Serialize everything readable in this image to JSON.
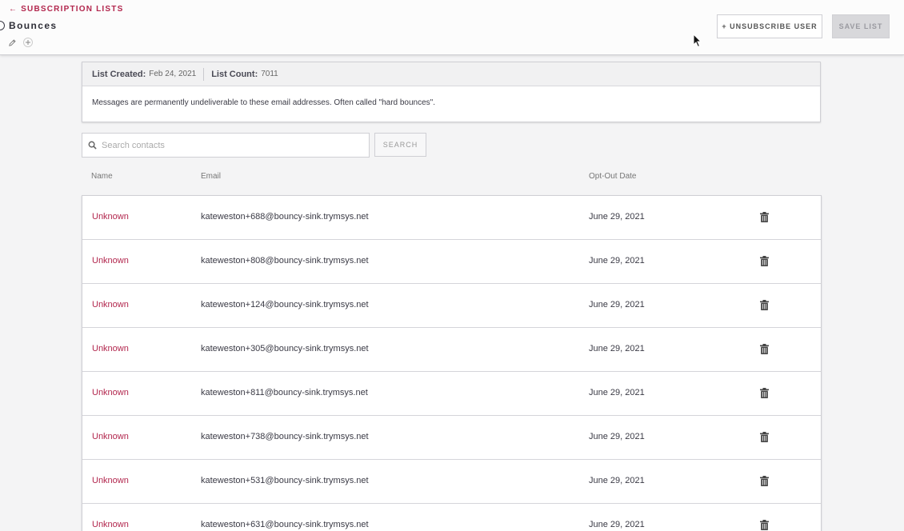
{
  "header": {
    "back_label": "← SUBSCRIPTION LISTS",
    "title": "Bounces",
    "unsubscribe_label": "+ UNSUBSCRIBE USER",
    "save_label": "SAVE LIST"
  },
  "info": {
    "created_label": "List Created:",
    "created_value": "Feb 24, 2021",
    "count_label": "List Count:",
    "count_value": "7011",
    "description": "Messages are permanently undeliverable to these email addresses. Often called \"hard bounces\"."
  },
  "search": {
    "placeholder": "Search contacts",
    "button_label": "SEARCH"
  },
  "table": {
    "columns": [
      "Name",
      "Email",
      "Opt-Out Date"
    ],
    "rows": [
      {
        "name": "Unknown",
        "email": "kateweston+688@bouncy-sink.trymsys.net",
        "date": "June 29, 2021"
      },
      {
        "name": "Unknown",
        "email": "kateweston+808@bouncy-sink.trymsys.net",
        "date": "June 29, 2021"
      },
      {
        "name": "Unknown",
        "email": "kateweston+124@bouncy-sink.trymsys.net",
        "date": "June 29, 2021"
      },
      {
        "name": "Unknown",
        "email": "kateweston+305@bouncy-sink.trymsys.net",
        "date": "June 29, 2021"
      },
      {
        "name": "Unknown",
        "email": "kateweston+811@bouncy-sink.trymsys.net",
        "date": "June 29, 2021"
      },
      {
        "name": "Unknown",
        "email": "kateweston+738@bouncy-sink.trymsys.net",
        "date": "June 29, 2021"
      },
      {
        "name": "Unknown",
        "email": "kateweston+531@bouncy-sink.trymsys.net",
        "date": "June 29, 2021"
      },
      {
        "name": "Unknown",
        "email": "kateweston+631@bouncy-sink.trymsys.net",
        "date": "June 29, 2021"
      }
    ]
  },
  "colors": {
    "accent": "#b2264d"
  }
}
